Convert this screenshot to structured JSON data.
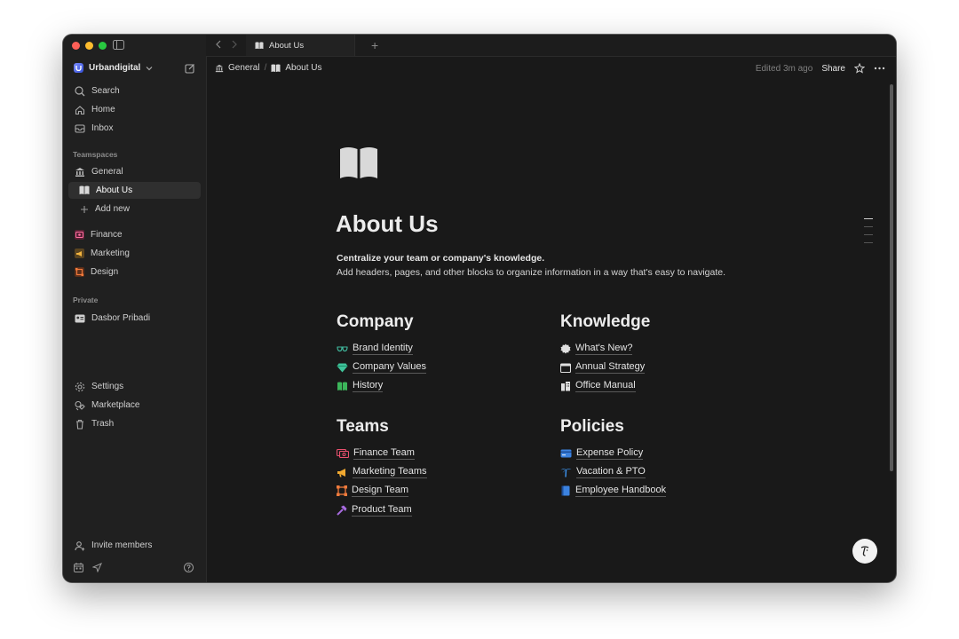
{
  "workspace": {
    "name": "Urbandigital"
  },
  "sidebar": {
    "nav": [
      {
        "label": "Search",
        "icon": "search-icon"
      },
      {
        "label": "Home",
        "icon": "home-icon"
      },
      {
        "label": "Inbox",
        "icon": "inbox-icon"
      }
    ],
    "teamspaces_label": "Teamspaces",
    "teamspaces": [
      {
        "label": "General",
        "icon": "bank-icon"
      },
      {
        "label": "About Us",
        "icon": "book-icon",
        "active": true
      },
      {
        "label": "Add new",
        "icon": "plus-icon"
      }
    ],
    "teams": [
      {
        "label": "Finance",
        "icon": "finance-icon",
        "color": "#e0457b"
      },
      {
        "label": "Marketing",
        "icon": "megaphone-icon",
        "color": "#e0a030"
      },
      {
        "label": "Design",
        "icon": "frame-icon",
        "color": "#e8642c"
      }
    ],
    "private_label": "Private",
    "private": [
      {
        "label": "Dasbor Pribadi",
        "icon": "id-card-icon"
      }
    ],
    "footer_nav": [
      {
        "label": "Settings",
        "icon": "gear-icon"
      },
      {
        "label": "Marketplace",
        "icon": "marketplace-icon"
      },
      {
        "label": "Trash",
        "icon": "trash-icon"
      }
    ],
    "invite_label": "Invite members"
  },
  "tabbar": {
    "tab_label": "About Us"
  },
  "breadcrumb": {
    "items": [
      "General",
      "About Us"
    ]
  },
  "toolbar": {
    "edited": "Edited 3m ago",
    "share": "Share"
  },
  "page": {
    "title": "About Us",
    "desc_bold": "Centralize your team or company's knowledge.",
    "desc": "Add headers, pages, and other blocks to organize information in a way that's easy to navigate."
  },
  "sections": {
    "company": {
      "heading": "Company",
      "links": [
        "Brand Identity",
        "Company Values",
        "History"
      ]
    },
    "knowledge": {
      "heading": "Knowledge",
      "links": [
        "What's New?",
        "Annual Strategy",
        "Office Manual"
      ]
    },
    "teams": {
      "heading": "Teams",
      "links": [
        "Finance Team",
        "Marketing Teams",
        "Design Team",
        "Product Team"
      ]
    },
    "policies": {
      "heading": "Policies",
      "links": [
        "Expense Policy",
        "Vacation & PTO",
        "Employee Handbook"
      ]
    }
  },
  "colors": {
    "background": "#191919",
    "sidebar": "#202020",
    "text": "#e6e6e6"
  }
}
